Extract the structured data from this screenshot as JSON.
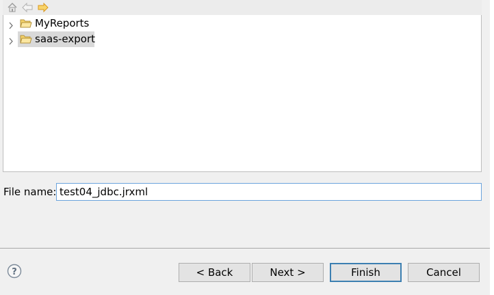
{
  "nav": {
    "home_icon": "home-icon",
    "back_icon": "back-arrow-icon",
    "forward_icon": "forward-arrow-icon"
  },
  "tree": {
    "items": [
      {
        "label": "MyReports",
        "icon": "folder-icon",
        "expander": "chevron-right-icon",
        "selected": false
      },
      {
        "label": "saas-export",
        "icon": "folder-icon",
        "expander": "chevron-right-icon",
        "selected": true
      }
    ]
  },
  "file_name": {
    "label": "File name:",
    "value": "test04_jdbc.jrxml"
  },
  "buttons": {
    "back": "< Back",
    "next": "Next >",
    "finish": "Finish",
    "cancel": "Cancel"
  },
  "help_icon": "help-icon",
  "colors": {
    "window_bg": "#f0f0f0",
    "selection_bg": "#d9d9d9",
    "default_button_border": "#3c7fb1",
    "input_focus_border": "#6aa3dc",
    "folder_yellow": "#f4d36b",
    "nav_arrow_orange": "#e9a521"
  }
}
